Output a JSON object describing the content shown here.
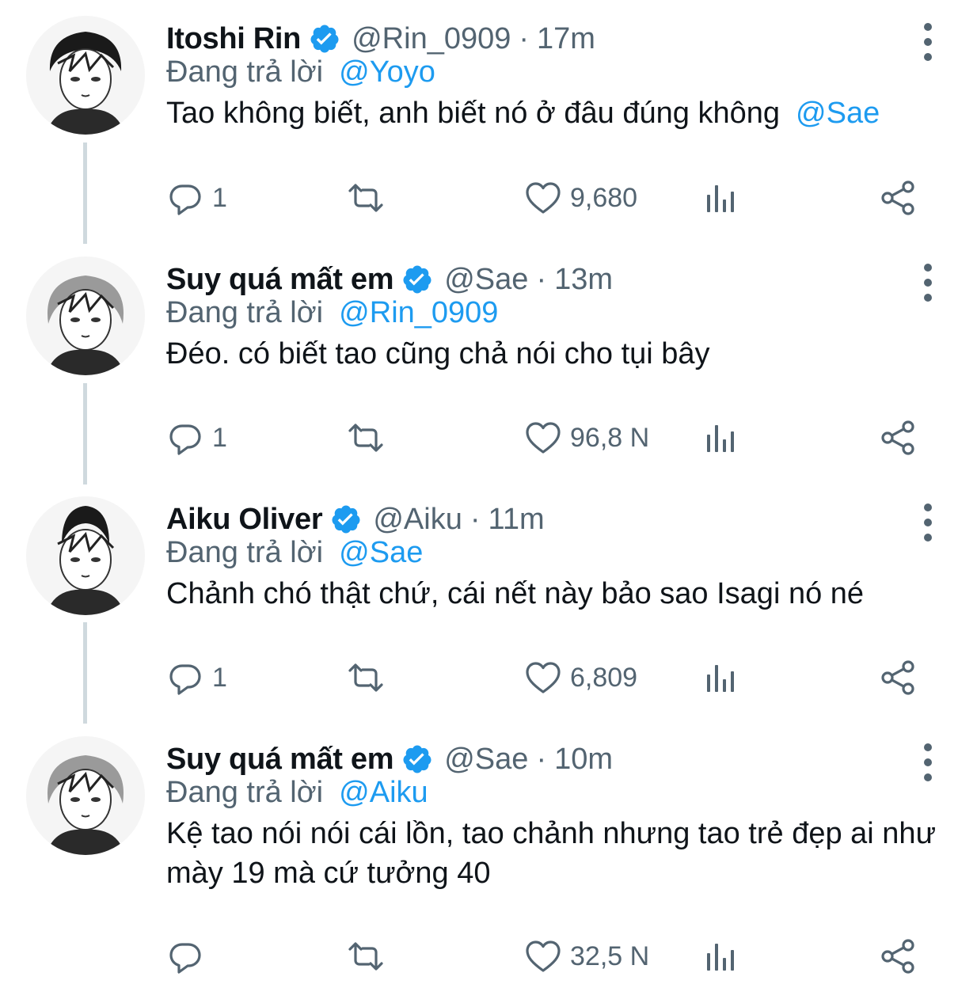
{
  "tweets": [
    {
      "name": "Itoshi Rin",
      "handle": "@Rin_0909",
      "separator": "·",
      "time": "17m",
      "replying_prefix": "Đang trả lời",
      "replying_to": "@Yoyo",
      "text": "Tao không biết, anh biết nó ở đâu đúng không",
      "text_mention": "@Sae",
      "reply_count": "1",
      "retweet_count": "",
      "like_count": "9,680"
    },
    {
      "name": "Suy quá mất em",
      "handle": "@Sae",
      "separator": "·",
      "time": "13m",
      "replying_prefix": "Đang trả lời",
      "replying_to": "@Rin_0909",
      "text": "Đéo. có biết tao cũng chả nói cho tụi bây",
      "text_mention": "",
      "reply_count": "1",
      "retweet_count": "",
      "like_count": "96,8 N"
    },
    {
      "name": "Aiku Oliver",
      "handle": "@Aiku",
      "separator": "·",
      "time": "11m",
      "replying_prefix": "Đang trả lời",
      "replying_to": "@Sae",
      "text": "Chảnh chó thật chứ, cái nết này bảo sao Isagi nó né",
      "text_mention": "",
      "reply_count": "1",
      "retweet_count": "",
      "like_count": "6,809"
    },
    {
      "name": "Suy quá mất em",
      "handle": "@Sae",
      "separator": "·",
      "time": "10m",
      "replying_prefix": "Đang trả lời",
      "replying_to": "@Aiku",
      "text": "Kệ tao nói nói cái lồn, tao chảnh nhưng tao trẻ đẹp ai như mày 19 mà cứ tưởng 40",
      "text_mention": "",
      "reply_count": "",
      "retweet_count": "",
      "like_count": "32,5 N"
    }
  ],
  "icons": {
    "verified": "verified-badge-icon",
    "more": "more-vertical-icon",
    "reply": "reply-bubble-icon",
    "retweet": "retweet-icon",
    "like": "heart-icon",
    "analytics": "analytics-bars-icon",
    "share": "share-icon"
  },
  "colors": {
    "accent": "#1d9bf0",
    "secondary_text": "#536471",
    "primary_text": "#0f1419",
    "thread_line": "#cfd9de"
  }
}
